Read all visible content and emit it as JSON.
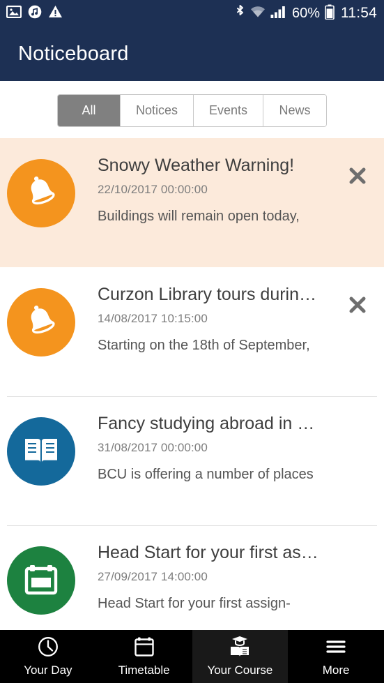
{
  "status_bar": {
    "icons_left": [
      "image-icon",
      "music-note-icon",
      "warning-triangle-icon"
    ],
    "bluetooth_icon": "bluetooth-icon",
    "wifi_icon": "wifi-icon",
    "signal_icon": "cellular-signal-icon",
    "battery_percent": "60%",
    "battery_icon": "battery-icon",
    "clock": "11:54"
  },
  "app_bar": {
    "title": "Noticeboard"
  },
  "tabs": {
    "items": [
      {
        "label": "All",
        "active": true
      },
      {
        "label": "Notices",
        "active": false
      },
      {
        "label": "Events",
        "active": false
      },
      {
        "label": "News",
        "active": false
      }
    ]
  },
  "notices": [
    {
      "title": "Snowy Weather Warning!",
      "date": "22/10/2017 00:00:00",
      "excerpt": "Buildings will remain open today,",
      "icon": "bell-icon",
      "icon_color": "#f4941e",
      "unread": true,
      "dismissible": true
    },
    {
      "title": "Curzon Library tours durin…",
      "date": "14/08/2017 10:15:00",
      "excerpt": "Starting on the 18th of September,",
      "icon": "bell-icon",
      "icon_color": "#f4941e",
      "unread": false,
      "dismissible": true
    },
    {
      "title": "Fancy studying abroad in …",
      "date": "31/08/2017 00:00:00",
      "excerpt": "BCU is offering a number of places",
      "icon": "open-book-icon",
      "icon_color": "#14699b",
      "unread": false,
      "dismissible": false
    },
    {
      "title": "Head Start for your first as…",
      "date": "27/09/2017 14:00:00",
      "excerpt": "Head Start for your first assign-",
      "icon": "calendar-icon",
      "icon_color": "#1d8240",
      "unread": false,
      "dismissible": false
    }
  ],
  "bottom_nav": {
    "items": [
      {
        "label": "Your Day",
        "icon": "clock-icon",
        "active": false
      },
      {
        "label": "Timetable",
        "icon": "calendar-icon",
        "active": false
      },
      {
        "label": "Your Course",
        "icon": "graduation-book-icon",
        "active": true
      },
      {
        "label": "More",
        "icon": "hamburger-menu-icon",
        "active": false
      }
    ]
  },
  "colors": {
    "header": "#1d3054",
    "unread_row": "#fceadb",
    "tab_active": "#808080",
    "orange": "#f4941e",
    "blue": "#14699b",
    "green": "#1d8240",
    "bottom_nav": "#000000"
  },
  "close_label": "✕"
}
